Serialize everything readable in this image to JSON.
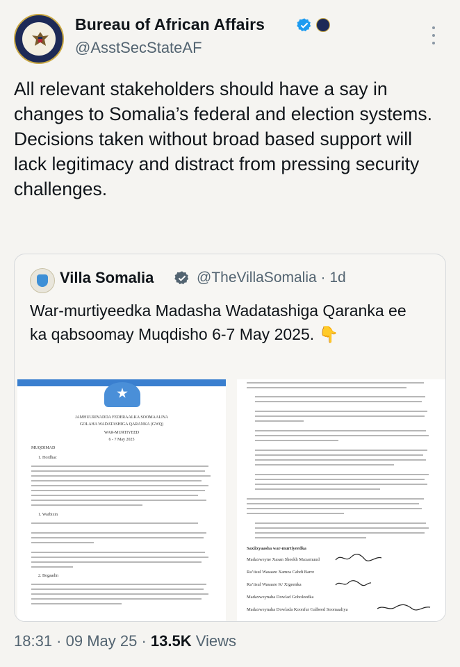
{
  "author": {
    "name": "Bureau of African Affairs",
    "handle": "@AsstSecStateAF"
  },
  "tweet_text": "All relevant stakeholders should have a say in changes to Somalia’s federal and election systems. Decisions taken without broad based support will lack legitimacy and distract from pressing security challenges.",
  "quote": {
    "name": "Villa Somalia",
    "handle": "@TheVillaSomalia · 1d",
    "text": "War-murtiyeedka Madasha Wadatashiga Qaranka ee ka qabsoomay Muqdisho 6-7 May 2025. 👇",
    "doc_left": {
      "title1": "JAMHUURIYADDA FEDERAALKA SOOMAALIYA",
      "title2": "GOLAHA WADATASHIGA QARANKA (GWQ)",
      "title3": "WAR-MURTIYEED",
      "date": "6 - 7 May 2025",
      "head1": "MUQDIMAD",
      "head2": "1.   Hordhac",
      "head3": "1.   Warbixin",
      "head4": "2.   Bogaadin"
    },
    "doc_right": {
      "sig_head": "Saxiixyaasha war-murtiyeedka",
      "sig1": "Madaxweyne Xasan Sheekh Maxamuud",
      "sig2": "Ra’iisul Wasaare Xamza Cabdi Barre",
      "sig3": "Ra’iisul Wasaare K/ Xigeenka",
      "sig4": "Madaxweynaha Dowlad Goboleedka",
      "sig5": "Madaxweynaha Dowlada Koonfur Galbeed Soomaaliya"
    }
  },
  "footer": {
    "time": "18:31 · 09 May 25 · ",
    "views": "13.5K",
    "views_label": " Views"
  },
  "colors": {
    "verified": "#1d9bf0",
    "muted": "#536471",
    "banner": "#3a7fcf"
  }
}
